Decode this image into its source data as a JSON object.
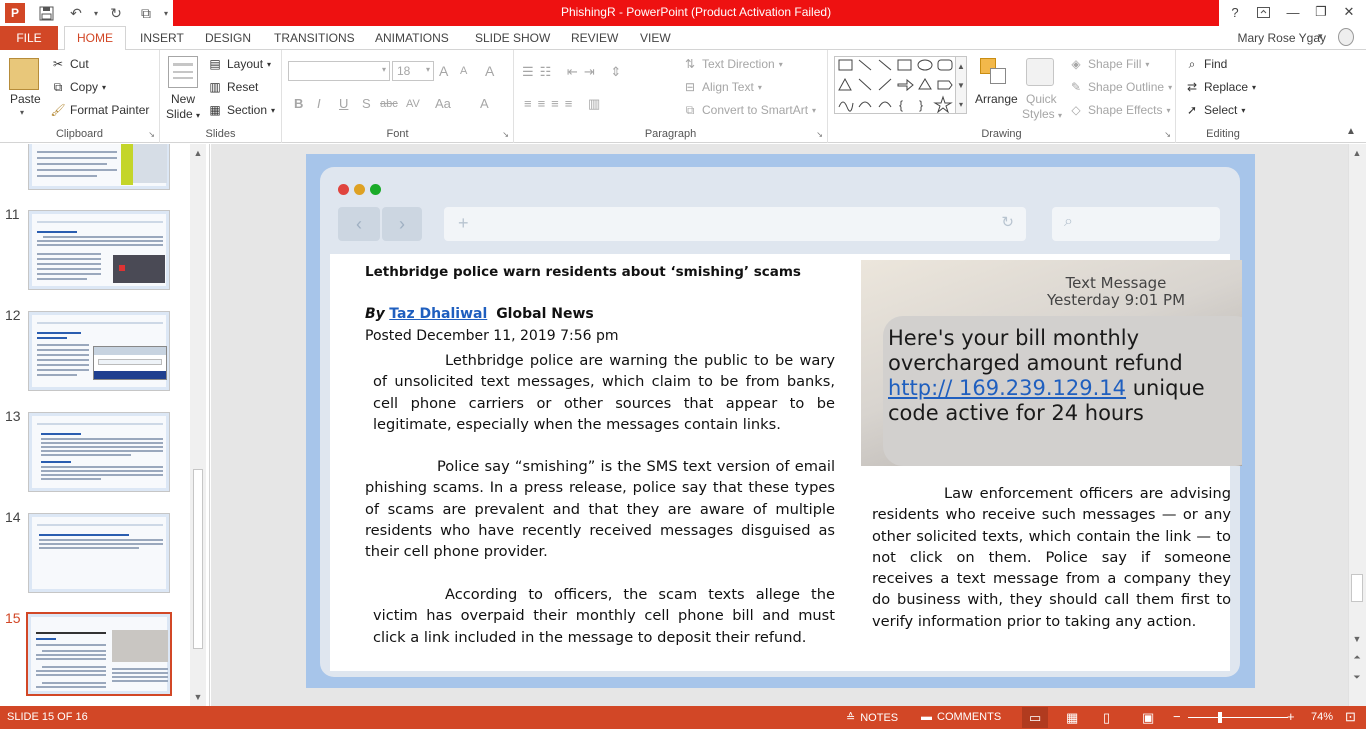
{
  "window": {
    "title": "PhishingR -  PowerPoint (Product Activation Failed)",
    "help": "?"
  },
  "tabs": [
    "FILE",
    "HOME",
    "INSERT",
    "DESIGN",
    "TRANSITIONS",
    "ANIMATIONS",
    "SLIDE SHOW",
    "REVIEW",
    "VIEW"
  ],
  "user": "Mary Rose Ygay",
  "ribbon": {
    "clipboard": {
      "paste": "Paste",
      "cut": "Cut",
      "copy": "Copy",
      "format_painter": "Format Painter",
      "label": "Clipboard"
    },
    "slides": {
      "new_slide_1": "New",
      "new_slide_2": "Slide",
      "layout": "Layout",
      "reset": "Reset",
      "section": "Section",
      "label": "Slides"
    },
    "font": {
      "size": "18",
      "bold": "B",
      "italic": "I",
      "underline": "U",
      "shadow": "S",
      "strike": "abc",
      "spacing": "AV",
      "case": "Aa",
      "color": "A",
      "grow": "A",
      "shrink": "A",
      "clear": "A",
      "label": "Font"
    },
    "paragraph": {
      "text_direction": "Text Direction",
      "align_text": "Align Text",
      "smartart": "Convert to SmartArt",
      "label": "Paragraph"
    },
    "drawing": {
      "arrange": "Arrange",
      "quick_styles_1": "Quick",
      "quick_styles_2": "Styles",
      "shape_fill": "Shape Fill",
      "shape_outline": "Shape Outline",
      "shape_effects": "Shape Effects",
      "label": "Drawing"
    },
    "editing": {
      "find": "Find",
      "replace": "Replace",
      "select": "Select",
      "label": "Editing"
    }
  },
  "slide_panel": {
    "items": [
      {
        "number": "11"
      },
      {
        "number": "12"
      },
      {
        "number": "13"
      },
      {
        "number": "14"
      },
      {
        "number": "15",
        "active": true
      }
    ]
  },
  "slide": {
    "headline": "Lethbridge police warn residents about ‘smishing’ scams",
    "by": "By",
    "author": "Taz Dhaliwal",
    "outlet": "Global News",
    "posted": "Posted December 11, 2019 7:56 pm",
    "paragraphs": [
      "Lethbridge police are warning the public to be wary of unsolicited text messages, which claim to be from banks, cell phone carriers or other sources that appear to be legitimate, especially when the messages contain links.",
      "Police say “smishing” is the SMS text version of email phishing scams. In a press release, police say that these types of scams are prevalent and that they are aware of multiple residents who have recently received messages disguised as their cell phone provider.",
      "According to officers, the scam texts allege the victim has overpaid their monthly cell phone bill and must click a link included in the message to deposit their refund.",
      "Law enforcement officers are advising residents who receive such messages — or any other solicited texts, which contain the link — to not click on them. Police say if someone receives a text message from a company they do business with, they should call them first to verify information prior to taking any action."
    ],
    "photo": {
      "header_1": "Text Message",
      "header_2": "Yesterday 9:01 PM",
      "message_before": "Here's your bill monthly overcharged amount refund ",
      "message_link": "http:// 169.239.129.14",
      "message_after": " unique code active for 24 hours"
    }
  },
  "status": {
    "slide_counter": "SLIDE 15 OF 16",
    "notes": "NOTES",
    "comments": "COMMENTS",
    "zoom": "74%"
  },
  "colors": {
    "accent": "#d24726",
    "title_bar": "#ee1111",
    "slide_frame": "#a7c5ea"
  }
}
